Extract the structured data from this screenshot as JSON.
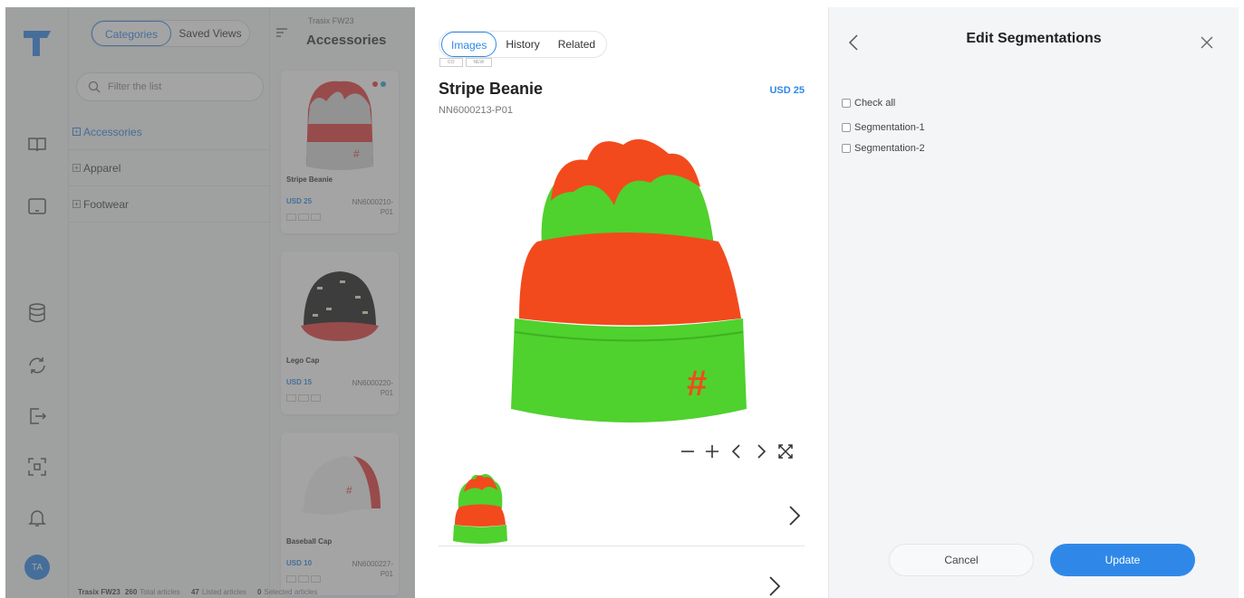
{
  "categories_panel": {
    "toggle": [
      "Categories",
      "Saved Views"
    ],
    "search_placeholder": "Filter the list",
    "items": [
      {
        "label": "Accessories",
        "active": true
      },
      {
        "label": "Apparel",
        "active": false
      },
      {
        "label": "Footwear",
        "active": false
      }
    ]
  },
  "articles_panel": {
    "season": "Trasix FW23",
    "title": "Accessories",
    "cards": [
      {
        "name": "Stripe Beanie",
        "price": "USD 25",
        "code": "NN6000210-P01",
        "image": "beanie-image"
      },
      {
        "name": "Lego Cap",
        "price": "USD 15",
        "code": "NN6000220-P01",
        "image": "cap-image"
      },
      {
        "name": "Baseball Cap",
        "price": "USD 10",
        "code": "NN6000227-P01",
        "image": "baseball-cap-image"
      }
    ]
  },
  "statusbar": {
    "season": "Trasix FW23",
    "total_count": "260",
    "total_label": "Total articles",
    "listed_count": "47",
    "listed_label": "Listed articles",
    "selected_count": "0",
    "selected_label": "Selected articles"
  },
  "rail": {
    "icons": [
      "book-icon",
      "monitor-icon",
      "database-icon",
      "sync-icon",
      "export-icon",
      "scan-icon",
      "bell-icon"
    ],
    "avatar": "TA"
  },
  "detail": {
    "tabs": [
      "Images",
      "History",
      "Related"
    ],
    "tags": [
      "CO",
      "NEW"
    ],
    "title": "Stripe Beanie",
    "price": "USD 25",
    "code": "NN6000213-P01"
  },
  "segmentations": {
    "title": "Edit Segmentations",
    "check_all": "Check all",
    "items": [
      "Segmentation-1",
      "Segmentation-2"
    ],
    "cancel": "Cancel",
    "update": "Update"
  },
  "colors": {
    "accent": "#2f88e8",
    "beanie_orange": "#f24a1d",
    "beanie_green": "#4fd12e"
  }
}
